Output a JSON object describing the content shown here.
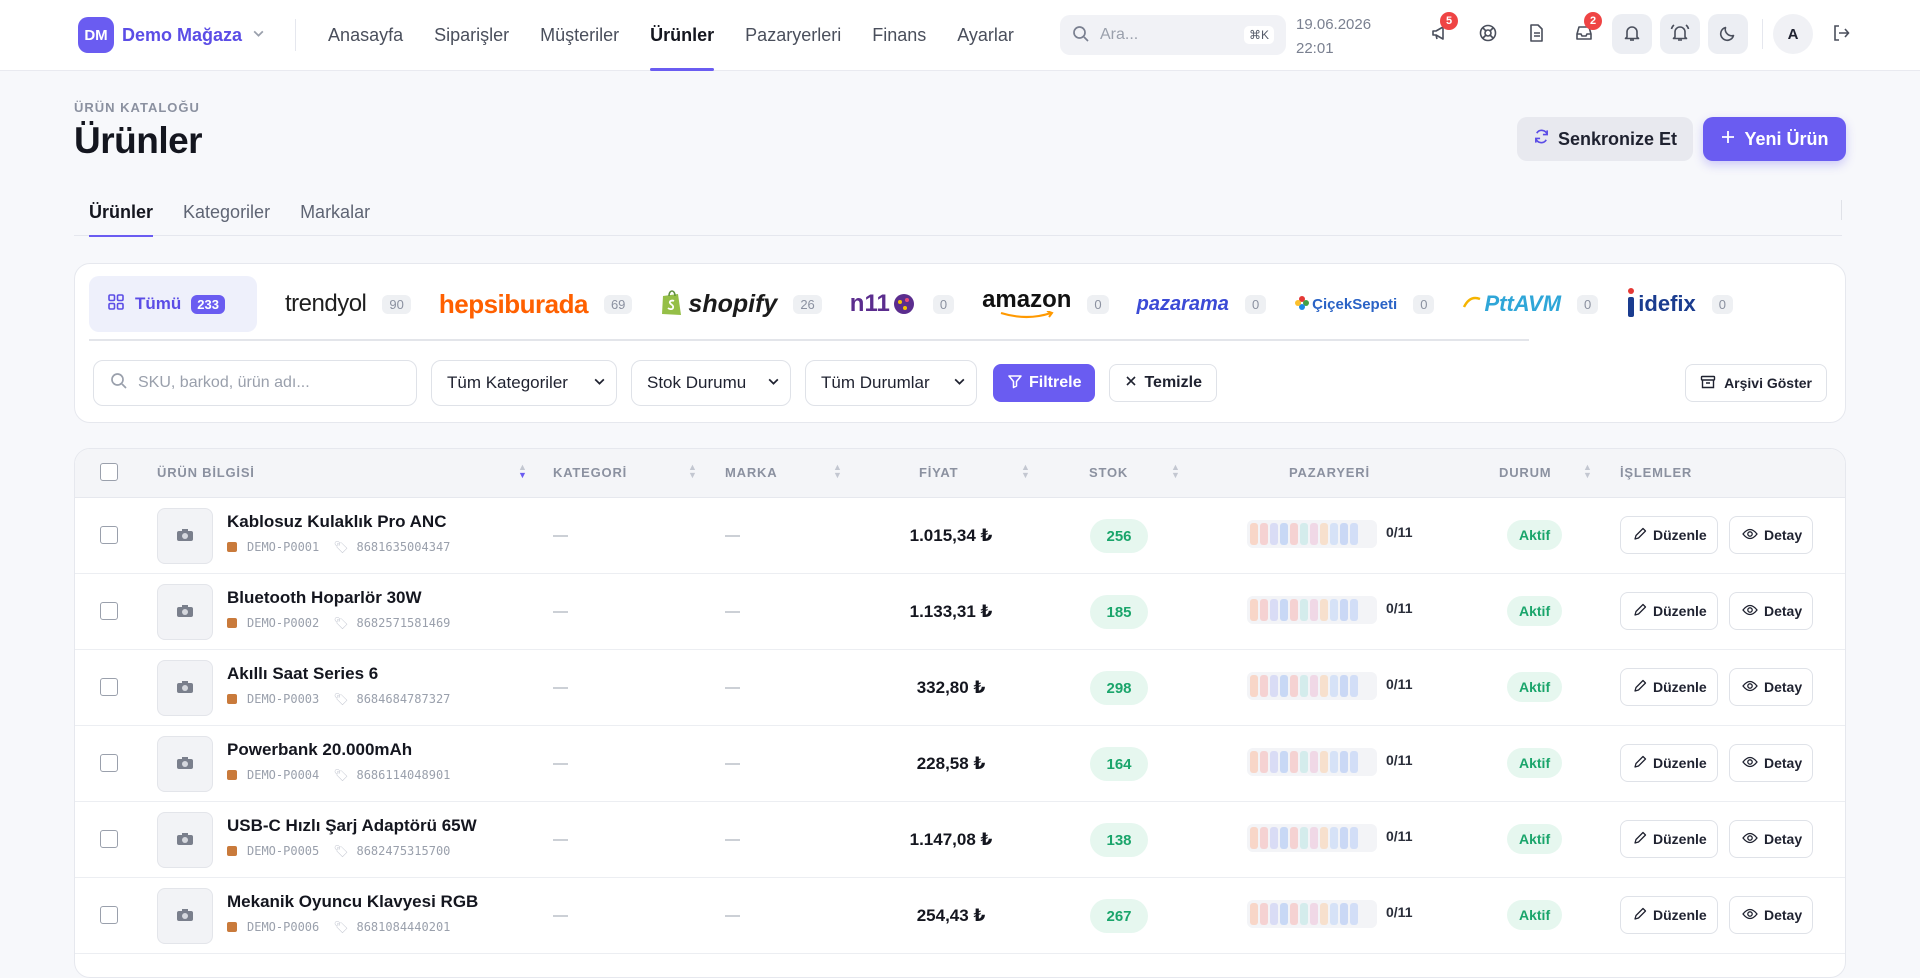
{
  "brand": {
    "logo_initials": "DM",
    "name": "Demo Mağaza"
  },
  "nav": [
    {
      "label": "Anasayfa",
      "active": false
    },
    {
      "label": "Siparişler",
      "active": false
    },
    {
      "label": "Müşteriler",
      "active": false
    },
    {
      "label": "Ürünler",
      "active": true
    },
    {
      "label": "Pazaryerleri",
      "active": false
    },
    {
      "label": "Finans",
      "active": false
    },
    {
      "label": "Ayarlar",
      "active": false
    }
  ],
  "search": {
    "placeholder": "Ara...",
    "shortcut": "⌘K"
  },
  "datetime": {
    "date": "19.06.2026",
    "time": "22:01"
  },
  "topbar_badges": {
    "announcements": "5",
    "inbox": "2"
  },
  "user": {
    "initial": "A"
  },
  "page": {
    "eyebrow": "ÜRÜN KATALOĞU",
    "title": "Ürünler"
  },
  "actions": {
    "sync": "Senkronize Et",
    "new": "Yeni Ürün"
  },
  "tabs": [
    {
      "label": "Ürünler",
      "active": true
    },
    {
      "label": "Kategoriler",
      "active": false
    },
    {
      "label": "Markalar",
      "active": false
    }
  ],
  "marketplaces": {
    "all": {
      "label": "Tümü",
      "count": "233"
    },
    "items": [
      {
        "name": "trendyol",
        "count": "90",
        "color": "#1f1f1f"
      },
      {
        "name": "hepsiburada",
        "count": "69",
        "color": "#ff6000"
      },
      {
        "name": "shopify",
        "count": "26",
        "color": "#1b1b1b"
      },
      {
        "name": "n11",
        "count": "0",
        "color": "#5b2d8e"
      },
      {
        "name": "amazon",
        "count": "0",
        "color": "#111111"
      },
      {
        "name": "pazarama",
        "count": "0",
        "color": "#3c4bd6"
      },
      {
        "name": "ÇiçekSepeti",
        "count": "0",
        "color": "#2a63c6"
      },
      {
        "name": "PttAVM",
        "count": "0",
        "color": "#2fa6d8"
      },
      {
        "name": "idefix",
        "count": "0",
        "color": "#1a3c8f"
      }
    ]
  },
  "filters": {
    "search_placeholder": "SKU, barkod, ürün adı...",
    "category": "Tüm Kategoriler",
    "stock": "Stok Durumu",
    "status": "Tüm Durumlar",
    "filter_btn": "Filtrele",
    "clear_btn": "Temizle",
    "archive_btn": "Arşivi Göster"
  },
  "table": {
    "headers": {
      "info": "ÜRÜN BİLGİSİ",
      "category": "KATEGORİ",
      "brand": "MARKA",
      "price": "FİYAT",
      "stock": "STOK",
      "marketplace": "PAZARYERİ",
      "status": "DURUM",
      "actions": "İŞLEMLER"
    },
    "edit_label": "Düzenle",
    "detail_label": "Detay",
    "rows": [
      {
        "name": "Kablosuz Kulaklık Pro ANC",
        "sku": "DEMO-P0001",
        "barcode": "8681635004347",
        "category": "—",
        "brand": "—",
        "price": "1.015,34 ₺",
        "stock": "256",
        "mp": "0/11",
        "status": "Aktif"
      },
      {
        "name": "Bluetooth Hoparlör 30W",
        "sku": "DEMO-P0002",
        "barcode": "8682571581469",
        "category": "—",
        "brand": "—",
        "price": "1.133,31 ₺",
        "stock": "185",
        "mp": "0/11",
        "status": "Aktif"
      },
      {
        "name": "Akıllı Saat Series 6",
        "sku": "DEMO-P0003",
        "barcode": "8684684787327",
        "category": "—",
        "brand": "—",
        "price": "332,80 ₺",
        "stock": "298",
        "mp": "0/11",
        "status": "Aktif"
      },
      {
        "name": "Powerbank 20.000mAh",
        "sku": "DEMO-P0004",
        "barcode": "8686114048901",
        "category": "—",
        "brand": "—",
        "price": "228,58 ₺",
        "stock": "164",
        "mp": "0/11",
        "status": "Aktif"
      },
      {
        "name": "USB-C Hızlı Şarj Adaptörü 65W",
        "sku": "DEMO-P0005",
        "barcode": "8682475315700",
        "category": "—",
        "brand": "—",
        "price": "1.147,08 ₺",
        "stock": "138",
        "mp": "0/11",
        "status": "Aktif"
      },
      {
        "name": "Mekanik Oyuncu Klavyesi RGB",
        "sku": "DEMO-P0006",
        "barcode": "8681084440201",
        "category": "—",
        "brand": "—",
        "price": "254,43 ₺",
        "stock": "267",
        "mp": "0/11",
        "status": "Aktif"
      }
    ]
  },
  "colors": {
    "accent": "#6a5cf1",
    "success": "#1aa56b",
    "danger": "#ef4444"
  }
}
